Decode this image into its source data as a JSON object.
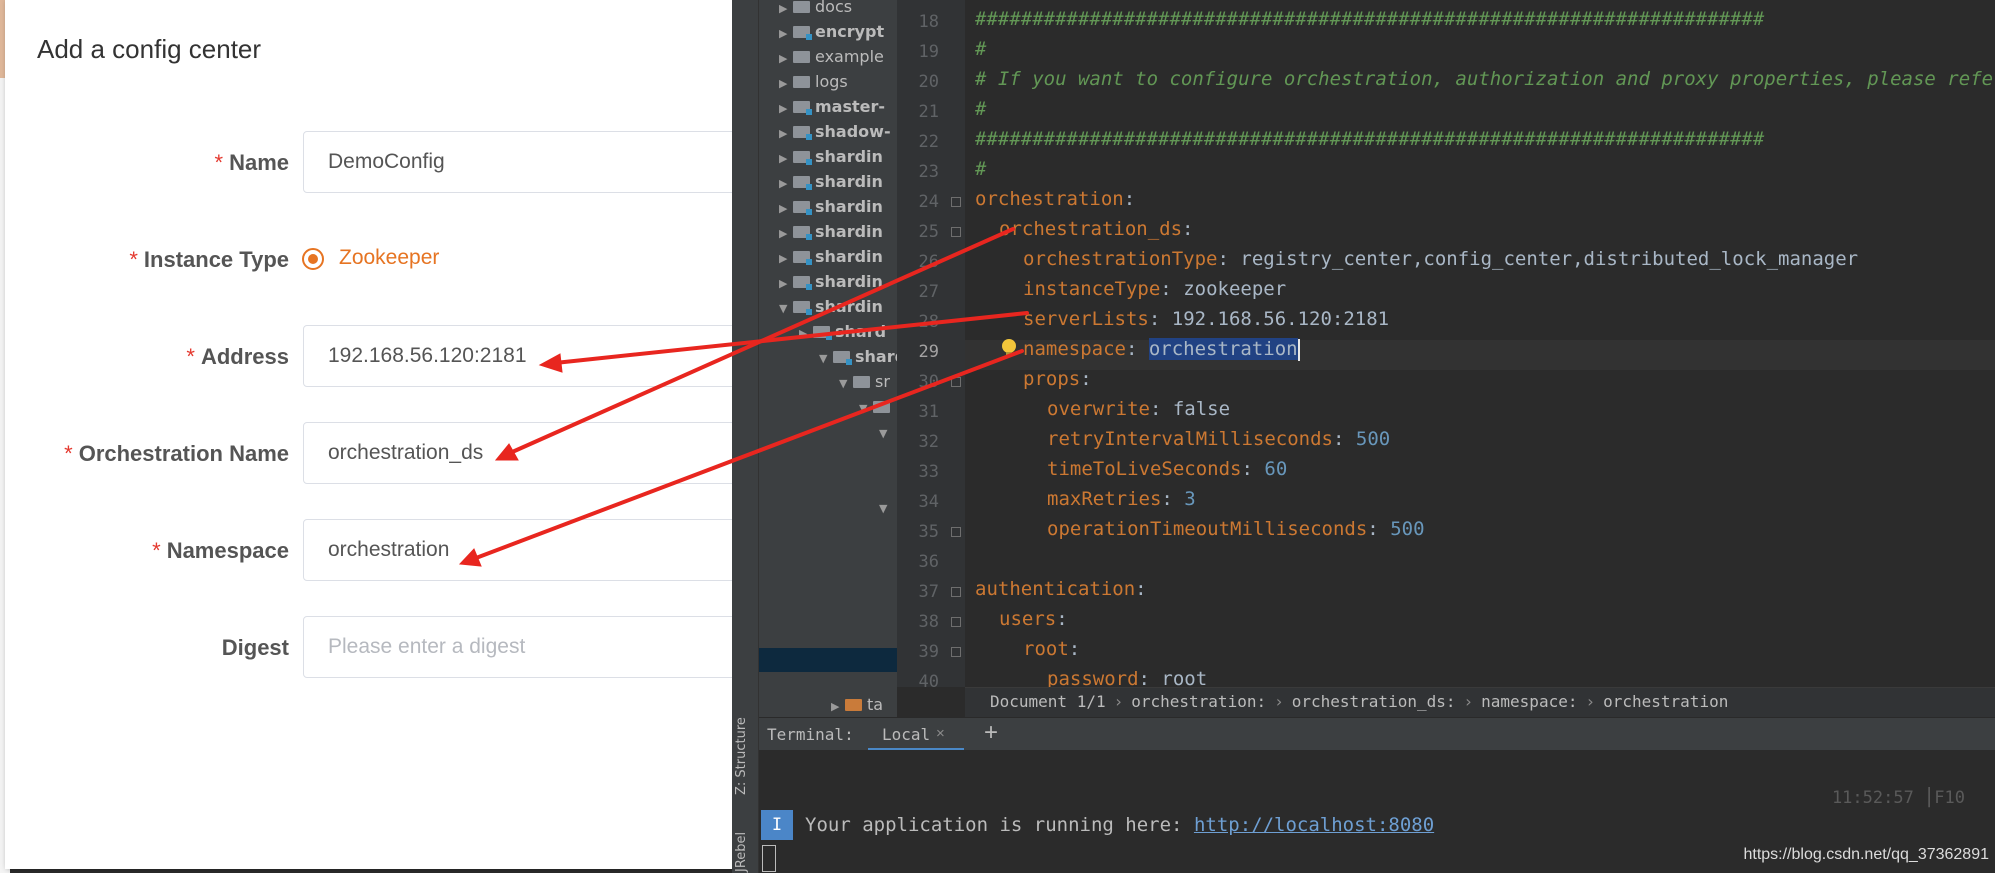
{
  "dialog": {
    "title": "Add a config center",
    "required_mark": "*",
    "fields": {
      "name": {
        "label": "Name",
        "value": "DemoConfig"
      },
      "instance_type": {
        "label": "Instance Type",
        "option": "Zookeeper"
      },
      "address": {
        "label": "Address",
        "value": "192.168.56.120:2181"
      },
      "orchestration_name": {
        "label": "Orchestration Name",
        "value": "orchestration_ds"
      },
      "namespace": {
        "label": "Namespace",
        "value": "orchestration"
      },
      "digest": {
        "label": "Digest",
        "value": "",
        "placeholder": "Please enter a digest"
      }
    }
  },
  "project_tree": {
    "items": [
      "docs",
      "encrypt",
      "example",
      "logs",
      "master-",
      "shadow-",
      "shardin",
      "shardin",
      "shardin",
      "shardin",
      "shardin",
      "shardin",
      "shardin",
      "shard",
      "shard",
      "sr",
      "ta"
    ]
  },
  "editor": {
    "line_numbers": [
      "18",
      "19",
      "20",
      "21",
      "22",
      "23",
      "24",
      "25",
      "26",
      "27",
      "28",
      "29",
      "30",
      "31",
      "32",
      "33",
      "34",
      "35",
      "36",
      "37",
      "38",
      "39",
      "40"
    ],
    "lines": {
      "l18": "#####################################################################",
      "l19": "#",
      "l20": "# If you want to configure orchestration, authorization and proxy properties, please refer to this example.",
      "l21": "#",
      "l22": "#####################################################################",
      "l23": "#",
      "l24_key": "orchestration",
      "l25_key": "orchestration_ds",
      "l26_key": "orchestrationType",
      "l26_val": "registry_center,config_center,distributed_lock_manager",
      "l27_key": "instanceType",
      "l27_val": "zookeeper",
      "l28_key": "serverLists",
      "l28_val": "192.168.56.120:2181",
      "l29_key": "namespace",
      "l29_val": "orchestration",
      "l30_key": "props",
      "l31_key": "overwrite",
      "l31_val": "false",
      "l32_key": "retryIntervalMilliseconds",
      "l32_val": "500",
      "l33_key": "timeToLiveSeconds",
      "l33_val": "60",
      "l34_key": "maxRetries",
      "l34_val": "3",
      "l35_key": "operationTimeoutMilliseconds",
      "l35_val": "500",
      "l37_key": "authentication",
      "l38_key": "users",
      "l39_key": "root",
      "l40_key": "password",
      "l40_val": "root",
      "colon": ":"
    }
  },
  "breadcrumb": {
    "items": [
      "Document 1/1",
      "orchestration:",
      "orchestration_ds:",
      "namespace:",
      "orchestration"
    ],
    "separator": "›"
  },
  "side_tabs": {
    "structure": "Z: Structure",
    "jrebel": "JRebel"
  },
  "terminal": {
    "label": "Terminal:",
    "tab": "Local",
    "close": "×",
    "add": "+",
    "time": "11:52:57  ⎮F10",
    "icon_label": "I",
    "message": "Your application is running here: ",
    "link": "http://localhost:8080"
  },
  "watermark": "https://blog.csdn.net/qq_37362891",
  "colors": {
    "accent_orange": "#e67422",
    "required_red": "#e4392f",
    "arrow_red": "#e8261f",
    "selection_blue": "#214283"
  }
}
